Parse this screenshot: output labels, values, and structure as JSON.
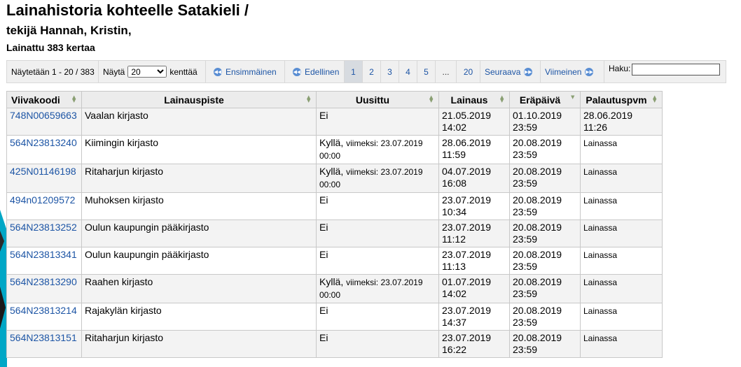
{
  "page": {
    "title": "Lainahistoria kohteelle Satakieli /",
    "author_line": "tekijä Hannah, Kristin,",
    "loan_count_line": "Lainattu 383 kertaa"
  },
  "pager": {
    "showing": "Näytetään 1 - 20 / 383",
    "show_label": "Näytä",
    "show_value": "20",
    "show_suffix": "kenttää",
    "first": "Ensimmäinen",
    "previous": "Edellinen",
    "pages": [
      "1",
      "2",
      "3",
      "4",
      "5",
      "...",
      "20"
    ],
    "active_page": "1",
    "next": "Seuraava",
    "last": "Viimeinen",
    "search_label": "Haku:",
    "search_value": ""
  },
  "table": {
    "headers": {
      "barcode": "Viivakoodi",
      "branch": "Lainauspiste",
      "renewed": "Uusittu",
      "checkout": "Lainaus",
      "due": "Eräpäivä",
      "returned": "Palautuspvm"
    },
    "rows": [
      {
        "barcode": "748N00659663",
        "branch": "Vaalan kirjasto",
        "renewed": "Ei",
        "renewed_detail": "",
        "checkout_date": "21.05.2019",
        "checkout_time": "14:02",
        "due_date": "01.10.2019",
        "due_time": "23:59",
        "returned_date": "28.06.2019",
        "returned_time": "11:26"
      },
      {
        "barcode": "564N23813240",
        "branch": "Kiimingin kirjasto",
        "renewed": "Kyllä,",
        "renewed_detail": "viimeksi: 23.07.2019 00:00",
        "checkout_date": "28.06.2019",
        "checkout_time": "11:59",
        "due_date": "20.08.2019",
        "due_time": "23:59",
        "returned_date": "Lainassa",
        "returned_time": ""
      },
      {
        "barcode": "425N01146198",
        "branch": "Ritaharjun kirjasto",
        "renewed": "Kyllä,",
        "renewed_detail": "viimeksi: 23.07.2019 00:00",
        "checkout_date": "04.07.2019",
        "checkout_time": "16:08",
        "due_date": "20.08.2019",
        "due_time": "23:59",
        "returned_date": "Lainassa",
        "returned_time": ""
      },
      {
        "barcode": "494n01209572",
        "branch": "Muhoksen kirjasto",
        "renewed": "Ei",
        "renewed_detail": "",
        "checkout_date": "23.07.2019",
        "checkout_time": "10:34",
        "due_date": "20.08.2019",
        "due_time": "23:59",
        "returned_date": "Lainassa",
        "returned_time": ""
      },
      {
        "barcode": "564N23813252",
        "branch": "Oulun kaupungin pääkirjasto",
        "renewed": "Ei",
        "renewed_detail": "",
        "checkout_date": "23.07.2019",
        "checkout_time": "11:12",
        "due_date": "20.08.2019",
        "due_time": "23:59",
        "returned_date": "Lainassa",
        "returned_time": ""
      },
      {
        "barcode": "564N23813341",
        "branch": "Oulun kaupungin pääkirjasto",
        "renewed": "Ei",
        "renewed_detail": "",
        "checkout_date": "23.07.2019",
        "checkout_time": "11:13",
        "due_date": "20.08.2019",
        "due_time": "23:59",
        "returned_date": "Lainassa",
        "returned_time": ""
      },
      {
        "barcode": "564N23813290",
        "branch": "Raahen kirjasto",
        "renewed": "Kyllä,",
        "renewed_detail": "viimeksi: 23.07.2019 00:00",
        "checkout_date": "01.07.2019",
        "checkout_time": "14:02",
        "due_date": "20.08.2019",
        "due_time": "23:59",
        "returned_date": "Lainassa",
        "returned_time": ""
      },
      {
        "barcode": "564N23813214",
        "branch": "Rajakylän kirjasto",
        "renewed": "Ei",
        "renewed_detail": "",
        "checkout_date": "23.07.2019",
        "checkout_time": "14:37",
        "due_date": "20.08.2019",
        "due_time": "23:59",
        "returned_date": "Lainassa",
        "returned_time": ""
      },
      {
        "barcode": "564N23813151",
        "branch": "Ritaharjun kirjasto",
        "renewed": "Ei",
        "renewed_detail": "",
        "checkout_date": "23.07.2019",
        "checkout_time": "16:22",
        "due_date": "20.08.2019",
        "due_time": "23:59",
        "returned_date": "Lainassa",
        "returned_time": ""
      }
    ]
  },
  "colors": {
    "link": "#1d55a5",
    "accent_stripe": "#00a7c6",
    "header_bg": "#ececec"
  }
}
